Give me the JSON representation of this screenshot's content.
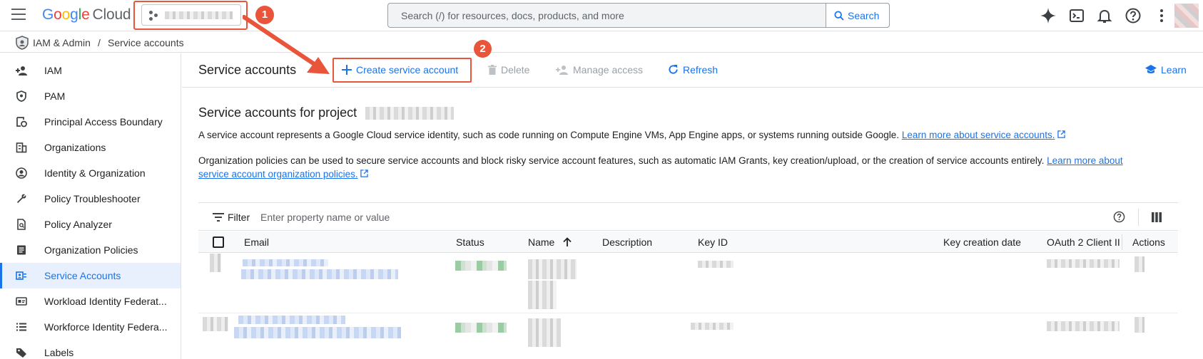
{
  "header": {
    "logo_google": "Google",
    "logo_cloud": "Cloud",
    "search_placeholder": "Search (/) for resources, docs, products, and more",
    "search_button": "Search"
  },
  "annotations": {
    "badge1": "1",
    "badge2": "2"
  },
  "breadcrumb": {
    "parent": "IAM & Admin",
    "separator": "/",
    "current": "Service accounts"
  },
  "sidebar": {
    "items": [
      {
        "label": "IAM",
        "icon": "person-add-icon"
      },
      {
        "label": "PAM",
        "icon": "shield-icon"
      },
      {
        "label": "Principal Access Boundary",
        "icon": "boundary-icon"
      },
      {
        "label": "Organizations",
        "icon": "building-icon"
      },
      {
        "label": "Identity & Organization",
        "icon": "account-circle-icon"
      },
      {
        "label": "Policy Troubleshooter",
        "icon": "wrench-icon"
      },
      {
        "label": "Policy Analyzer",
        "icon": "document-search-icon"
      },
      {
        "label": "Organization Policies",
        "icon": "list-doc-icon"
      },
      {
        "label": "Service Accounts",
        "icon": "service-account-icon",
        "active": true
      },
      {
        "label": "Workload Identity Federat...",
        "icon": "id-card-icon"
      },
      {
        "label": "Workforce Identity Federa...",
        "icon": "list-icon"
      },
      {
        "label": "Labels",
        "icon": "label-icon"
      }
    ]
  },
  "toolbar": {
    "title": "Service accounts",
    "create": "Create service account",
    "delete": "Delete",
    "manage_access": "Manage access",
    "refresh": "Refresh",
    "learn": "Learn"
  },
  "content": {
    "section_title": "Service accounts for project",
    "para1": "A service account represents a Google Cloud service identity, such as code running on Compute Engine VMs, App Engine apps, or systems running outside Google.",
    "para1_link": "Learn more about service accounts.",
    "para2": "Organization policies can be used to secure service accounts and block risky service account features, such as automatic IAM Grants, key creation/upload, or the creation of service accounts entirely.",
    "para2_link_a": "Learn more about",
    "para2_link_b": "service account organization policies."
  },
  "filter": {
    "label": "Filter",
    "placeholder": "Enter property name or value"
  },
  "table": {
    "columns": [
      "Email",
      "Status",
      "Name",
      "Description",
      "Key ID",
      "Key creation date",
      "OAuth 2 Client II",
      "Actions"
    ],
    "sorted_column": "Name",
    "sort_direction": "ascending"
  },
  "colors": {
    "accent": "#1a73e8",
    "annotation": "#e8553a",
    "active_bg": "#e8f0fe"
  }
}
